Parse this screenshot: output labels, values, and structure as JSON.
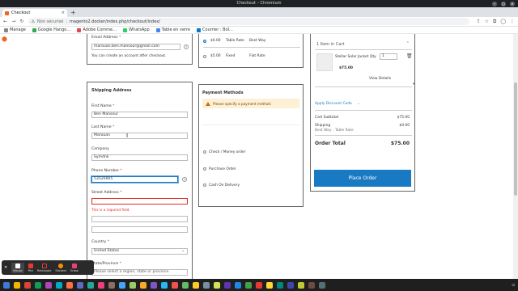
{
  "window": {
    "title": "Checkout – Chromium"
  },
  "tab": {
    "title": "Checkout",
    "close": "×",
    "new": "+"
  },
  "address": {
    "security": "Non sécurisé",
    "url": "magento2.docker/index.php/checkout/index/"
  },
  "bookmarks": [
    {
      "label": "Manage",
      "color": "#888888"
    },
    {
      "label": "Google Hango…",
      "color": "#34a853"
    },
    {
      "label": "Adobe Comme…",
      "color": "#e34850"
    },
    {
      "label": "WhatsApp",
      "color": "#25d366"
    },
    {
      "label": "Table en verre",
      "color": "#4285f4"
    },
    {
      "label": "Courrier : Boî…",
      "color": "#0078d4"
    }
  ],
  "email_block": {
    "label": "Email Address",
    "value": "marouan.ben.mansour@gmail.com",
    "note": "You can create an account after checkout."
  },
  "shipping": {
    "title": "Shipping Address",
    "first_name": {
      "label": "First Name",
      "value": "Ben Mansour"
    },
    "last_name": {
      "label": "Last Name",
      "value": "Marouan"
    },
    "company": {
      "label": "Company",
      "value": "Symdnk"
    },
    "phone": {
      "label": "Phone Number",
      "value": "53526905"
    },
    "street": {
      "label": "Street Address",
      "error": "This is a required field."
    },
    "country": {
      "label": "Country",
      "value": "United States"
    },
    "region": {
      "label": "State/Province",
      "placeholder": "Please select a region, state or province."
    }
  },
  "rates": [
    {
      "price": "$0.00",
      "method": "Table Rate",
      "carrier": "Best Way",
      "selected": true
    },
    {
      "price": "$5.00",
      "method": "Fixed",
      "carrier": "Flat Rate",
      "selected": false
    }
  ],
  "payment": {
    "title": "Payment Methods",
    "warning": "Please specify a payment method.",
    "options": [
      "Check / Money order",
      "Purchase Order",
      "Cash On Delivery"
    ]
  },
  "cart": {
    "heading": "1 Item in Cart",
    "product": "Stellar Solar Jacket",
    "qty_label": "Qty",
    "qty": "1",
    "price": "$75.00",
    "view_details": "View Details",
    "discount": "Apply Discount Code",
    "subtotal_label": "Cart Subtotal",
    "subtotal": "$75.00",
    "shipping_label": "Shipping",
    "shipping_method": "Best Way - Table Rate",
    "shipping": "$0.00",
    "total_label": "Order Total",
    "total": "$75.00",
    "place_order": "Place Order"
  },
  "annotate_tools": [
    "Mouse",
    "Pen",
    "Rectangle",
    "Stickers",
    "Erase"
  ],
  "colors": {
    "accent": "#1979c3",
    "error": "#e02b27",
    "magento": "#f26322"
  }
}
